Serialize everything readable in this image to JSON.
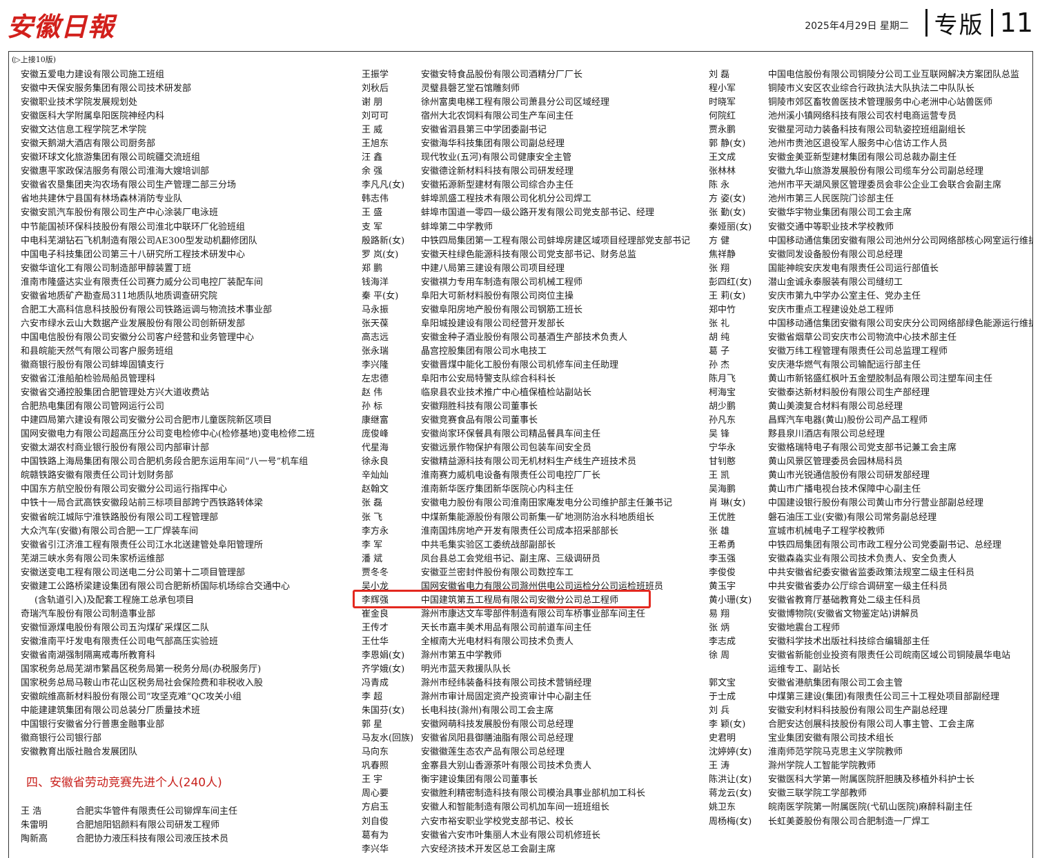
{
  "masthead": {
    "logo": "安徽日報",
    "date": "2025年4月29日  星期二",
    "section": "专版",
    "page": "11"
  },
  "continued": "(▷上接10版)",
  "col1_units": [
    "安徽五爱电力建设有限公司施工班组",
    "安徽中天保安服务集团有限公司技术研发部",
    "安徽职业技术学院发展规划处",
    "安徽医科大学附属阜阳医院神经内科",
    "安徽文达信息工程学院艺术学院",
    "安徽天鹅湖大酒店有限公司厨务部",
    "安徽环球文化旅游集团有限公司皖疆交流班组",
    "安徽惠平家政保洁服务有限公司淮海大嫂培训部",
    "安徽省农垦集团夹沟农场有限公司生产管理二部三分场",
    "省地共建休宁县国有林场森林消防专业队",
    "安徽安凯汽车股份有限公司生产中心涂装厂电泳班",
    "中节能国祯环保科技股份有限公司淮北中联环厂化验班组",
    "中电科芜湖钻石飞机制造有限公司AE300型发动机翻修团队",
    "中国电子科技集团公司第三十八研究所工程技术研发中心",
    "安徽华谊化工有限公司制造部甲醇装置丁班",
    "淮南市隆盛达实业有限责任公司赛力威分公司电控厂装配车间",
    "安徽省地质矿产勘查局311地质队地质调查研究院",
    "合肥工大高科信息科技股份有限公司铁路运调与物流技术事业部",
    "六安市绿水云山大数据产业发展股份有限公司创新研发部",
    "中国电信股份有限公司安徽分公司客户经营和业务管理中心",
    "和县皖能天然气有限公司客户服务班组",
    "徽商银行股份有限公司蚌埠固镇支行",
    "安徽省江淮船舶检验局船员管理科",
    "安徽省交通控股集团合肥管理处方兴大道收费站",
    "合肥热电集团有限公司管网运行公司",
    "中建四局第六建设有限公司安徽分公司合肥市儿童医院新区项目",
    "国网安徽电力有限公司超高压分公司变电检修中心(检修基地)变电检修二班",
    "安徽太湖农村商业银行股份有限公司内部审计部",
    "中国铁路上海局集团有限公司合肥机务段合肥东运用车间“八一号”机车组",
    "皖赣铁路安徽有限责任公司计划财务部",
    "中国东方航空股份有限公司安徽分公司运行指挥中心",
    "中铁十一局合武高铁安徽段站前三标项目部跨宁西铁路转体梁",
    "安徽省皖江城际宁淮铁路股份有限公司工程管理部",
    "大众汽车(安徽)有限公司合肥一工厂焊装车间",
    "安徽省引江济淮工程有限责任公司江水北送建管处阜阳管理所",
    "芜湖三峡水务有限公司朱家桥运维部",
    "安徽送变电工程有限公司送电二分公司第十二项目管理部",
    "安徽建工公路桥梁建设集团有限公司合肥新桥国际机场综合交通中心",
    "(含轨道引入)及配套工程施工总承包项目",
    "奇瑞汽车股份有限公司制造事业部",
    "安徽恒源煤电股份有限公司五沟煤矿采煤区二队",
    "安徽淮南平圩发电有限责任公司电气部高压实验班",
    "安徽省南湖强制隔离戒毒所教育科",
    "国家税务总局芜湖市繁昌区税务局第一税务分局(办税服务厅)",
    "国家税务总局马鞍山市花山区税务局社会保险费和非税收入股",
    "安徽皖维高新材料股份有限公司“攻坚克难”QC攻关小组",
    "中能建建筑集团有限公司总装分厂质量技术班",
    "中国银行安徽省分行普惠金融事业部",
    "徽商银行公司银行部",
    "安徽教育出版社融合发展团队"
  ],
  "heading4": "四、安徽省劳动竞赛先进个人(240人)",
  "col1_people": [
    {
      "name": "王  浩",
      "unit": "合肥实华管件有限责任公司铆焊车间主任"
    },
    {
      "name": "朱雷明",
      "unit": "合肥旭阳铝颜料有限公司研发工程师"
    },
    {
      "name": "陶新高",
      "unit": "合肥协力液压科技有限公司液压技术员"
    }
  ],
  "col2_people": [
    {
      "name": "王振学",
      "unit": "安徽安特食品股份有限公司酒精分厂厂长"
    },
    {
      "name": "刘秋后",
      "unit": "灵璧县磬艺堂石馆雕刻师"
    },
    {
      "name": "谢  朋",
      "unit": "徐州富奥电梯工程有限公司萧县分公司区域经理"
    },
    {
      "name": "刘可可",
      "unit": "宿州大北农饲料有限公司生产车间主任"
    },
    {
      "name": "王  威",
      "unit": "安徽省泗县第三中学团委副书记"
    },
    {
      "name": "王旭东",
      "unit": "安徽海华科技集团有限公司副总经理"
    },
    {
      "name": "汪  鑫",
      "unit": "现代牧业(五河)有限公司健康安全主管"
    },
    {
      "name": "余  强",
      "unit": "安徽德诠新材料科技有限公司研发经理"
    },
    {
      "name": "李凡凡(女)",
      "unit": "安徽拓源新型建材有限公司综合办主任"
    },
    {
      "name": "韩志伟",
      "unit": "蚌埠凯盛工程技术有限公司化机分公司焊工"
    },
    {
      "name": "王  盛",
      "unit": "蚌埠市国道一零四一级公路开发有限公司党支部书记、经理"
    },
    {
      "name": "支  军",
      "unit": "蚌埠第二中学教师"
    },
    {
      "name": "殷路新(女)",
      "unit": "中铁四局集团第一工程有限公司蚌埠房建区域项目经理部党支部书记"
    },
    {
      "name": "罗  岚(女)",
      "unit": "安徽天柱绿色能源科技有限公司党支部书记、财务总监"
    },
    {
      "name": "郑  鹏",
      "unit": "中建八局第三建设有限公司项目经理"
    },
    {
      "name": "钱海洋",
      "unit": "安徽祺力专用车制造有限公司机械工程师"
    },
    {
      "name": "秦  平(女)",
      "unit": "阜阳大可新材料股份有限公司岗位主操"
    },
    {
      "name": "马永振",
      "unit": "安徽阜阳房地产股份有限公司钢筋工班长"
    },
    {
      "name": "张天葆",
      "unit": "阜阳城投建设有限公司经营开发部长"
    },
    {
      "name": "高志远",
      "unit": "安徽金种子酒业股份有限公司基酒生产部技术负责人"
    },
    {
      "name": "张永瑞",
      "unit": "晶宫控股集团有限公司水电技工"
    },
    {
      "name": "李兴隆",
      "unit": "安徽晋煤中能化工股份有限公司机修车间主任助理"
    },
    {
      "name": "左忠德",
      "unit": "阜阳市公安局特警支队综合科科长"
    },
    {
      "name": "赵  伟",
      "unit": "临泉县农业技术推广中心植保植检站副站长"
    },
    {
      "name": "孙  标",
      "unit": "安徽翔胜科技有限公司董事长"
    },
    {
      "name": "康继富",
      "unit": "安徽竞赛食品有限公司董事长"
    },
    {
      "name": "庞俊峰",
      "unit": "安徽尚家环保餐具有限公司精品餐具车间主任"
    },
    {
      "name": "代星海",
      "unit": "安徽远景作物保护有限公司包装车间安全员"
    },
    {
      "name": "徐永良",
      "unit": "安徽精益源科技有限公司无机材料生产线生产班技术员"
    },
    {
      "name": "辛灿灿",
      "unit": "淮南赛力威机电设备有限责任公司电控厂厂长"
    },
    {
      "name": "赵翰文",
      "unit": "淮南新华医疗集团新华医院心内科主任"
    },
    {
      "name": "张  磊",
      "unit": "安徽电力股份有限公司淮南田家庵发电分公司维护部主任兼书记"
    },
    {
      "name": "张  飞",
      "unit": "中煤新集能源股份有限公司新集一矿地测防治水科地质组长"
    },
    {
      "name": "李方永",
      "unit": "淮南国炜房地产开发有限责任公司成本招采部部长"
    },
    {
      "name": "李  军",
      "unit": "中共毛集实验区工委统战部副部长"
    },
    {
      "name": "潘  斌",
      "unit": "凤台县总工会党组书记、副主席、三级调研员"
    },
    {
      "name": "贾冬冬",
      "unit": "安徽亚兰密封件股份有限公司数控车工"
    },
    {
      "name": "吴小龙",
      "unit": "国网安徽省电力有限公司滁州供电公司运检分公司运检班班员"
    },
    {
      "name": "李辉强",
      "unit": "中国建筑第五工程局有限公司安徽分公司总工程师"
    },
    {
      "name": "崔金良",
      "unit": "滁州市康达文车零部件制造有限公司车桥事业部车间主任"
    },
    {
      "name": "王传才",
      "unit": "天长市嘉丰美术用品有限公司前道车间主任"
    },
    {
      "name": "王仕华",
      "unit": "全椒南大光电材料有限公司技术负责人"
    },
    {
      "name": "李恩娟(女)",
      "unit": "滁州市第五中学教师"
    },
    {
      "name": "齐学娥(女)",
      "unit": "明光市蓝天救援队队长"
    },
    {
      "name": "冯青成",
      "unit": "滁州市经纬装备科技有限公司技术营销经理"
    },
    {
      "name": "李  超",
      "unit": "滁州市审计局固定资产投资审计中心副主任"
    },
    {
      "name": "朱国芬(女)",
      "unit": "长电科技(滁州)有限公司工会主席"
    },
    {
      "name": "郭  星",
      "unit": "安徽网萌科技发展股份有限公司总经理"
    },
    {
      "name": "马友水(回族)",
      "unit": "安徽省凤阳县御膳油脂有限公司总经理"
    },
    {
      "name": "马向东",
      "unit": "安徽徽莲生态农产品有限公司总经理"
    },
    {
      "name": "巩春照",
      "unit": "金寨县大别山香源茶叶有限公司技术负责人"
    },
    {
      "name": "王  宇",
      "unit": "衡宇建设集团有限公司董事长"
    },
    {
      "name": "周心要",
      "unit": "安徽胜利精密制造科技有限公司模治具事业部机加工科长"
    },
    {
      "name": "方启玉",
      "unit": "安徽人和智能制造有限公司机加车间一班班组长"
    },
    {
      "name": "刘自俊",
      "unit": "六安市裕安职业学校党支部书记、校长"
    },
    {
      "name": "葛有为",
      "unit": "安徽省六安市叶集丽人木业有限公司机修班长"
    },
    {
      "name": "李兴华",
      "unit": "六安经济技术开发区总工会副主席"
    }
  ],
  "col3_people": [
    {
      "name": "刘  磊",
      "unit": "中国电信股份有限公司铜陵分公司工业互联网解决方案团队总监"
    },
    {
      "name": "程小军",
      "unit": "铜陵市义安区农业综合行政执法大队执法二中队队长"
    },
    {
      "name": "时晓军",
      "unit": "铜陵市郊区畜牧兽医技术管理服务中心老洲中心站兽医师"
    },
    {
      "name": "何院红",
      "unit": "池州溪小镇网络科技有限公司农村电商运营专员"
    },
    {
      "name": "贾永鹏",
      "unit": "安徽星河动力装备科技有限公司轨姿控班组副组长"
    },
    {
      "name": "郭  静(女)",
      "unit": "池州市贵池区退役军人服务中心信访工作人员"
    },
    {
      "name": "王文成",
      "unit": "安徽金美亚新型建材集团有限公司总裁办副主任"
    },
    {
      "name": "张林林",
      "unit": "安徽九华山旅游发展股份有限公司缆车分公司副总经理"
    },
    {
      "name": "陈  永",
      "unit": "池州市平天湖风景区管理委员会非公企业工会联合会副主席"
    },
    {
      "name": "方  姿(女)",
      "unit": "池州市第三人民医院门诊部主任"
    },
    {
      "name": "张  勤(女)",
      "unit": "安徽华宇物业集团有限公司工会主席"
    },
    {
      "name": "秦娅丽(女)",
      "unit": "安徽交通中等职业技术学校教师"
    },
    {
      "name": "方  健",
      "unit": "中国移动通信集团安徽有限公司池州分公司网络部核心网室运行维护"
    },
    {
      "name": "焦祥静",
      "unit": "安徽同发设备股份有限公司总经理"
    },
    {
      "name": "张  翔",
      "unit": "国能神皖安庆发电有限责任公司运行部值长"
    },
    {
      "name": "彭四红(女)",
      "unit": "潜山金诚永泰服装有限公司缝纫工"
    },
    {
      "name": "王  莉(女)",
      "unit": "安庆市第九中学办公室主任、党办主任"
    },
    {
      "name": "郑中竹",
      "unit": "安庆市重点工程建设处总工程师"
    },
    {
      "name": "张  礼",
      "unit": "中国移动通信集团安徽有限公司安庆分公司网络部绿色能源运行维护"
    },
    {
      "name": "胡  纯",
      "unit": "安徽省烟草公司安庆市公司物流中心技术部主任"
    },
    {
      "name": "葛  子",
      "unit": "安徽万纬工程管理有限责任公司总监理工程师"
    },
    {
      "name": "孙  杰",
      "unit": "安庆港华燃气有限公司输配运行部主任"
    },
    {
      "name": "陈月飞",
      "unit": "黄山市新铭盛红枫叶五金塑胶制品有限公司注塑车间主任"
    },
    {
      "name": "柯海宝",
      "unit": "安徽泰达新材料股份有限公司生产部经理"
    },
    {
      "name": "胡少鹏",
      "unit": "黄山美澳复合材料有限公司总经理"
    },
    {
      "name": "孙凡东",
      "unit": "昌辉汽车电器(黄山)股份公司产品工程师"
    },
    {
      "name": "吴  锋",
      "unit": "黟县泉川酒店有限公司总经理"
    },
    {
      "name": "宁华永",
      "unit": "安徽格瑞特电子有限公司党支部书记兼工会主席"
    },
    {
      "name": "甘钊憨",
      "unit": "黄山风景区管理委员会园林局科员"
    },
    {
      "name": "王  凯",
      "unit": "黄山市光锐通信股份有限公司研发部经理"
    },
    {
      "name": "吴海鹏",
      "unit": "黄山市广播电视台技术保障中心副主任"
    },
    {
      "name": "肖  琳(女)",
      "unit": "中国建设银行股份有限公司黄山市分行营业部副总经理"
    },
    {
      "name": "王优胜",
      "unit": "磐石油压工业(安徽)有限公司常务副总经理"
    },
    {
      "name": "张  雄",
      "unit": "宣城市机械电子工程学校教师"
    },
    {
      "name": "王希勇",
      "unit": "中铁四局集团有限公司市政工程分公司党委副书记、总经理"
    },
    {
      "name": "李玉强",
      "unit": "安徽森淼实业有限公司技术负责人、安全负责人"
    },
    {
      "name": "李俊俊",
      "unit": "中共安徽省纪委安徽省监委政策法规室二级主任科员"
    },
    {
      "name": "黄玉宇",
      "unit": "中共安徽省委办公厅综合调研室一级主任科员"
    },
    {
      "name": "黄小珊(女)",
      "unit": "安徽省教育厅基础教育处二级主任科员"
    },
    {
      "name": "易  翔",
      "unit": "安徽博物院(安徽省文物鉴定站)讲解员"
    },
    {
      "name": "张  炳",
      "unit": "安徽地震台工程师"
    },
    {
      "name": "李志成",
      "unit": "安徽科学技术出版社科技综合编辑部主任"
    },
    {
      "name": "徐  周",
      "unit": "安徽省新能创业投资有限责任公司皖南区域公司铜陵晨华电站"
    },
    {
      "name": "",
      "unit": "运维专工、副站长"
    },
    {
      "name": "郭文宝",
      "unit": "安徽省港航集团有限公司工会主管"
    },
    {
      "name": "于士成",
      "unit": "中煤第三建设(集团)有限责任公司三十工程处项目部副经理"
    },
    {
      "name": "刘  兵",
      "unit": "安徽安利材料科技股份有限公司生产副总经理"
    },
    {
      "name": "李  颖(女)",
      "unit": "合肥安达创展科技股份有限公司人事主管、工会主席"
    },
    {
      "name": "史君明",
      "unit": "宝业集团安徽有限公司技术组长"
    },
    {
      "name": "沈婷婷(女)",
      "unit": "淮南师范学院马克思主义学院教师"
    },
    {
      "name": "王  涛",
      "unit": "滁州学院人工智能学院教师"
    },
    {
      "name": "陈洪让(女)",
      "unit": "安徽医科大学第一附属医院肝胆胰及移植外科护士长"
    },
    {
      "name": "蒋龙云(女)",
      "unit": "安徽三联学院工学部教师"
    },
    {
      "name": "姚卫东",
      "unit": "皖南医学院第一附属医院(弋矶山医院)麻醉科副主任"
    },
    {
      "name": "周杨梅(女)",
      "unit": "长虹美菱股份有限公司合肥制造一厂焊工"
    }
  ]
}
